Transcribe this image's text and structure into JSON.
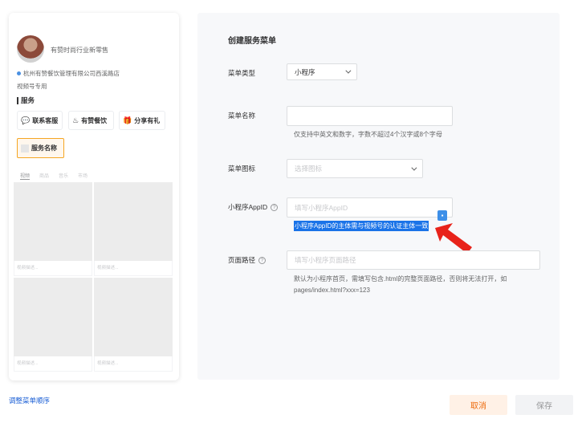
{
  "preview": {
    "shop_name": "有赞时尚行业新零售",
    "address": "杭州有赞餐饮管理有限公司西溪路店",
    "address_sub": "视频号专用",
    "services_title": "服务",
    "service_buttons": [
      {
        "icon": "chat-icon",
        "glyph": "💬",
        "label": "联系客服"
      },
      {
        "icon": "chef-hat-icon",
        "glyph": "♨",
        "label": "有赞餐饮"
      },
      {
        "icon": "gift-icon",
        "glyph": "🎁",
        "label": "分享有礼"
      }
    ],
    "service_name_box": "服务名称",
    "tabs": [
      "视频",
      "商品",
      "音乐",
      "市场"
    ],
    "card_captions": [
      "视频描述...",
      "视频描述...",
      "视频描述...",
      "视频描述..."
    ]
  },
  "reorder_link": "调整菜单顺序",
  "form": {
    "title": "创建服务菜单",
    "menu_type": {
      "label": "菜单类型",
      "value": "小程序"
    },
    "menu_name": {
      "label": "菜单名称",
      "value": "",
      "hint": "仅支持中英文和数字，字数不超过4个汉字或8个字母"
    },
    "menu_icon": {
      "label": "菜单图标",
      "placeholder": "选择图标"
    },
    "appid": {
      "label": "小程序AppID",
      "placeholder": "填写小程序AppID",
      "hint": "小程序AppID的主体需与视频号的认证主体一致"
    },
    "page_path": {
      "label": "页面路径",
      "placeholder": "填写小程序页面路径",
      "hint_line1": "默认为小程序首页，需填写包含.html的完整页面路径，否则将无法打开，如",
      "hint_line2": "pages/index.html?xxx=123"
    },
    "help_glyph": "?"
  },
  "buttons": {
    "cancel": "取消",
    "save": "保存"
  },
  "colors": {
    "accent_orange": "#ed6a0c",
    "link_blue": "#155bd4",
    "selection_blue": "#1a73e8",
    "arrow_red": "#e8231a"
  }
}
